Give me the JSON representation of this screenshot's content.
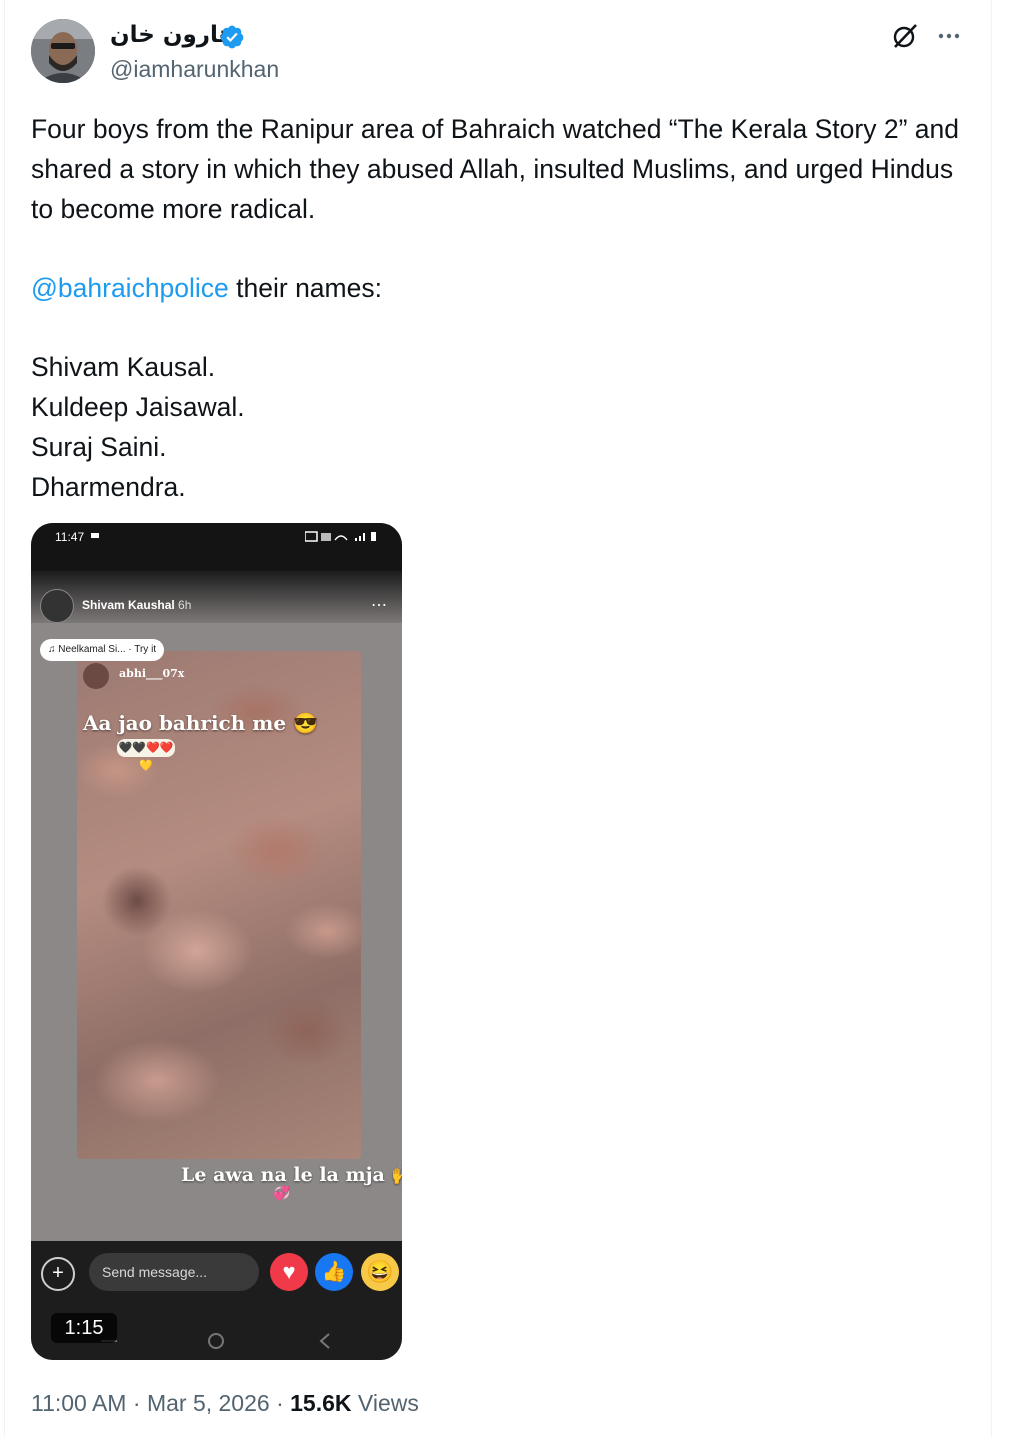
{
  "author": {
    "display_name": "هارون خان",
    "handle": "@iamharunkhan",
    "verified": true
  },
  "tweet": {
    "paragraph1": "Four boys from the Ranipur area of Bahraich watched “The Kerala Story 2” and shared a story in which they abused Allah, insulted Muslims, and urged Hindus to become more radical.",
    "mention": "@bahraichpolice",
    "mention_suffix": " their names:",
    "names": [
      "Shivam Kausal.",
      "Kuldeep Jaisawal.",
      "Suraj Saini.",
      "Dharmendra."
    ]
  },
  "media": {
    "status_time": "11:47",
    "story_user": "Shivam Kaushal",
    "story_age": "6h",
    "music_chip": "Neelkamal Si... · Try it",
    "reply_user": "abhi___07x",
    "caption_top": "Aa jao bahrich me 😎",
    "hearts": "🖤🖤❤️❤️💛",
    "caption_bottom": "Le awa na le la mja 🙌",
    "message_placeholder": "Send message...",
    "duration": "1:15"
  },
  "meta": {
    "time": "11:00 AM",
    "date": "Mar 5, 2026",
    "views_count": "15.6K",
    "views_label": "Views",
    "separator": "·"
  },
  "icons": {
    "verified": "verified-badge-icon",
    "grok": "grok-icon",
    "more": "more-icon"
  },
  "colors": {
    "accent": "#1d9bf0",
    "secondary_text": "#536471",
    "primary_text": "#0f1419"
  }
}
